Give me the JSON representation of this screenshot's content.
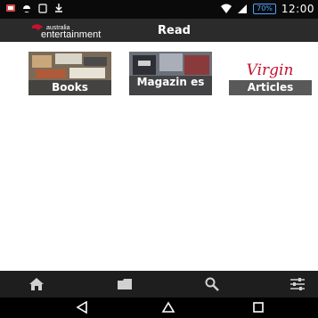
{
  "status_bar": {
    "time": "12:00",
    "battery_label": "70%",
    "icons": [
      "notification-icon",
      "signal-icon",
      "wifi-icon",
      "battery-icon"
    ]
  },
  "app_bar": {
    "logo_line1": "australia",
    "logo_line2": "entertainment",
    "title": "Read"
  },
  "tiles": [
    {
      "label": "Books"
    },
    {
      "label": "Magazin es"
    },
    {
      "label": "Articles",
      "brand": "Virgin"
    }
  ],
  "toolbar": {
    "items": [
      "home-icon",
      "library-icon",
      "search-icon",
      "settings-icon"
    ]
  },
  "nav": {
    "items": [
      "back-icon",
      "home-icon",
      "recents-icon"
    ]
  },
  "colors": {
    "status_bar": "#0a0a0a",
    "app_bar": "#2b2b2b",
    "accent": "#4aa3ff",
    "brand_red": "#c4122f",
    "toolbar": "#1e1e1e"
  }
}
